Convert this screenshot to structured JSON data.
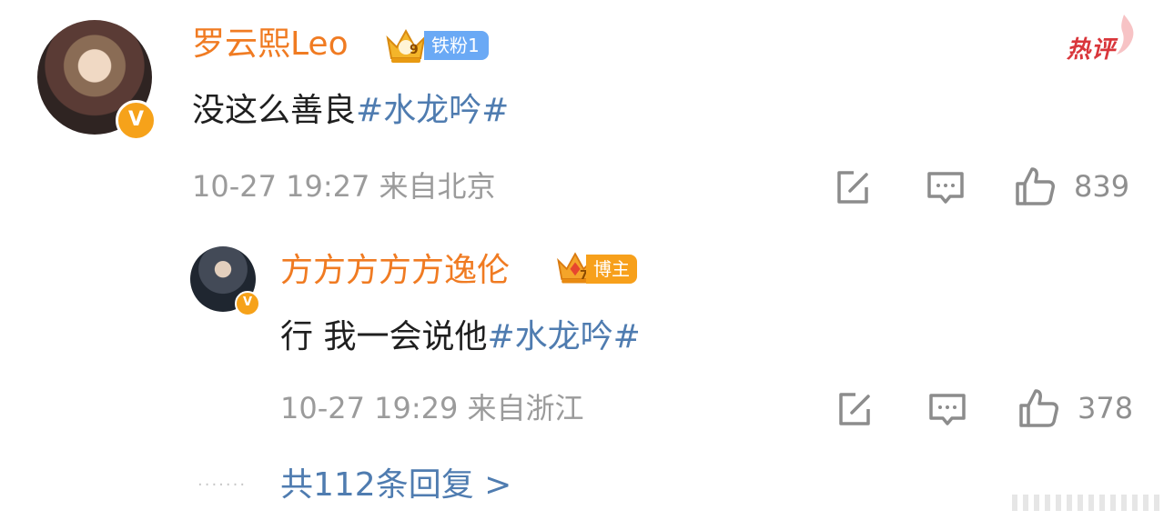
{
  "hot_label": "热评",
  "main_comment": {
    "username": "罗云熙Leo",
    "badge_level": "9",
    "fan_badge": "铁粉1",
    "verified_icon": "v-verified-icon",
    "text": "没这么善良",
    "hashtag": "#水龙吟#",
    "meta": "10-27 19:27 来自北京",
    "likes": "839"
  },
  "reply": {
    "username": "方方方方方逸伦",
    "badge_level": "7",
    "role_badge": "博主",
    "verified_icon": "v-verified-icon",
    "text": "行 我一会说他",
    "hashtag": "#水龙吟#",
    "meta": "10-27 19:29 来自浙江",
    "likes": "378"
  },
  "replies_link": "共112条回复 >",
  "dots": "·······",
  "colors": {
    "username": "#f07b22",
    "hashtag": "#4f7cb0",
    "meta": "#9b9b9b",
    "fan_badge": "#6aa9f5",
    "blogger_badge": "#f7a01b",
    "hot": "#d9363b"
  }
}
